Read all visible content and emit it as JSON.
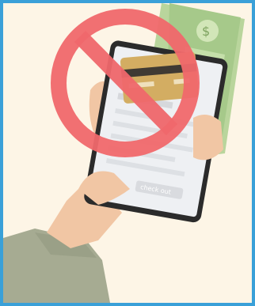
{
  "illustration": {
    "phone_button_label": "check out"
  }
}
